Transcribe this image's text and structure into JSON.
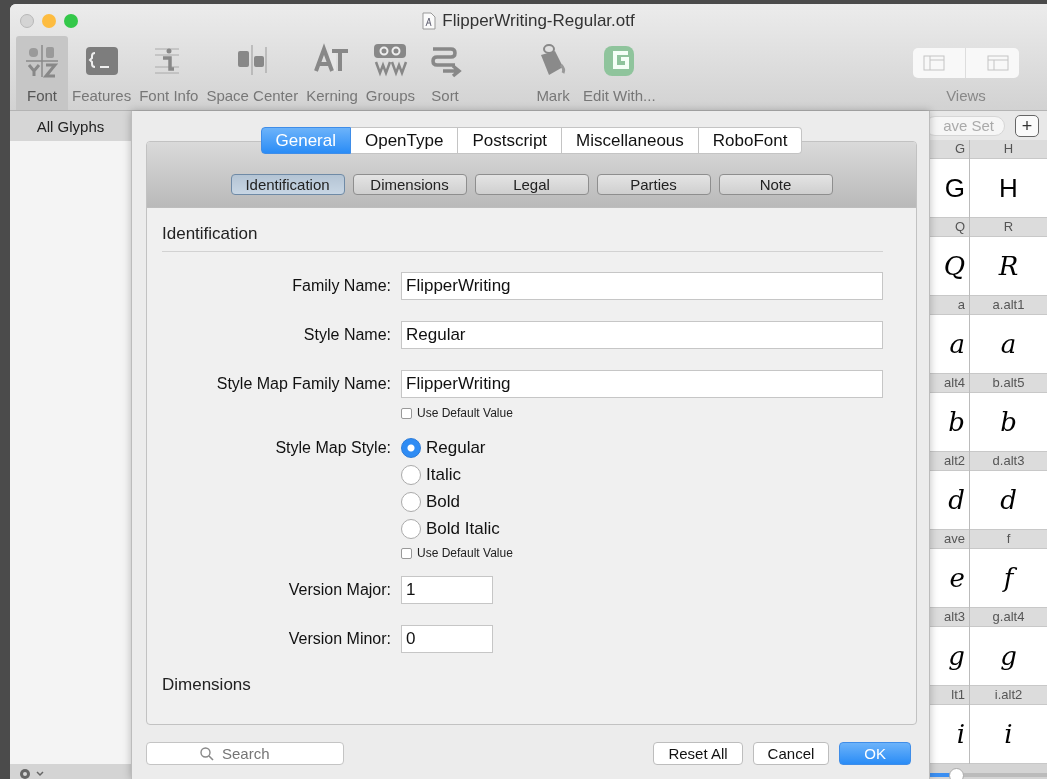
{
  "window": {
    "title": "FlipperWriting-Regular.otf"
  },
  "tools": [
    {
      "label": "Font",
      "selected": true
    },
    {
      "label": "Features",
      "selected": false
    },
    {
      "label": "Font Info",
      "selected": false
    },
    {
      "label": "Space Center",
      "selected": false
    },
    {
      "label": "Kerning",
      "selected": false
    },
    {
      "label": "Groups",
      "selected": false
    },
    {
      "label": "Sort",
      "selected": false
    }
  ],
  "actions": [
    {
      "label": "Mark"
    },
    {
      "label": "Edit With..."
    }
  ],
  "views": {
    "label": "Views"
  },
  "sidebar": {
    "header": "All Glyphs"
  },
  "glyph_bar": {
    "save_set": "ave Set",
    "add": "+"
  },
  "glyph_rows": [
    [
      {
        "name": "G",
        "glyph": "G",
        "script": false
      },
      {
        "name": "H",
        "glyph": "H",
        "script": false
      }
    ],
    [
      {
        "name": "Q",
        "glyph": "Q",
        "script": true
      },
      {
        "name": "R",
        "glyph": "R",
        "script": true
      }
    ],
    [
      {
        "name": "a",
        "glyph": "a",
        "script": true
      },
      {
        "name": "a.alt1",
        "glyph": "a",
        "script": true
      }
    ],
    [
      {
        "name": "alt4",
        "glyph": "b",
        "script": true
      },
      {
        "name": "b.alt5",
        "glyph": "b",
        "script": true
      }
    ],
    [
      {
        "name": "alt2",
        "glyph": "d",
        "script": true
      },
      {
        "name": "d.alt3",
        "glyph": "d",
        "script": true
      }
    ],
    [
      {
        "name": "ave",
        "glyph": "e",
        "script": true
      },
      {
        "name": "f",
        "glyph": "f",
        "script": true
      }
    ],
    [
      {
        "name": "alt3",
        "glyph": "g",
        "script": true
      },
      {
        "name": "g.alt4",
        "glyph": "g",
        "script": true
      }
    ],
    [
      {
        "name": "lt1",
        "glyph": "i",
        "script": true
      },
      {
        "name": "i.alt2",
        "glyph": "i",
        "script": true
      }
    ]
  ],
  "zoom_slider": {
    "level": 0.25
  },
  "sheet": {
    "tabs": [
      {
        "label": "General",
        "selected": true
      },
      {
        "label": "OpenType",
        "selected": false
      },
      {
        "label": "Postscript",
        "selected": false
      },
      {
        "label": "Miscellaneous",
        "selected": false
      },
      {
        "label": "RoboFont",
        "selected": false
      }
    ],
    "subtabs": [
      {
        "label": "Identification",
        "selected": true
      },
      {
        "label": "Dimensions",
        "selected": false
      },
      {
        "label": "Legal",
        "selected": false
      },
      {
        "label": "Parties",
        "selected": false
      },
      {
        "label": "Note",
        "selected": false
      }
    ],
    "section": "Identification",
    "fields": [
      {
        "kind": "text",
        "label": "Family Name:",
        "value": "FlipperWriting"
      },
      {
        "kind": "text",
        "label": "Style Name:",
        "value": "Regular"
      },
      {
        "kind": "text",
        "label": "Style Map Family Name:",
        "value": "FlipperWriting"
      },
      {
        "kind": "checkbox",
        "label": "Use Default Value",
        "checked": false
      },
      {
        "kind": "radio",
        "label": "Style Map Style:",
        "options": [
          {
            "label": "Regular",
            "selected": true
          },
          {
            "label": "Italic",
            "selected": false
          },
          {
            "label": "Bold",
            "selected": false
          },
          {
            "label": "Bold Italic",
            "selected": false
          }
        ]
      },
      {
        "kind": "checkbox",
        "label": "Use Default Value",
        "checked": false
      },
      {
        "kind": "short",
        "label": "Version Major:",
        "value": "1"
      },
      {
        "kind": "short",
        "label": "Version Minor:",
        "value": "0"
      }
    ],
    "next_section": "Dimensions",
    "search": {
      "placeholder": "Search"
    },
    "buttons": [
      {
        "label": "Reset All",
        "default": false
      },
      {
        "label": "Cancel",
        "default": false
      },
      {
        "label": "OK",
        "default": true
      }
    ]
  }
}
